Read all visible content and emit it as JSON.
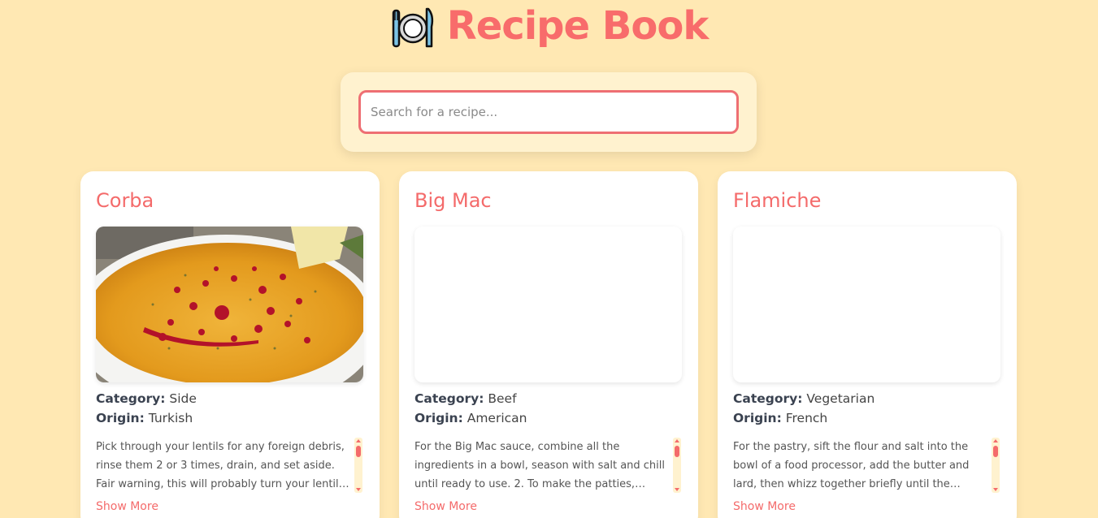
{
  "header": {
    "title": "Recipe Book",
    "logo_icon": "plate-fork-knife-icon"
  },
  "search": {
    "placeholder": "Search for a recipe...",
    "value": ""
  },
  "colors": {
    "background": "#ffe8b3",
    "accent": "#f86c6b",
    "search_border": "#ee6f73"
  },
  "cards": [
    {
      "title": "Corba",
      "category_label": "Category:",
      "category": "Side",
      "origin_label": "Origin:",
      "origin": "Turkish",
      "description": "Pick through your lentils for any foreign debris, rinse them 2 or 3 times, drain, and set aside. Fair warning, this will probably turn your lentils into a...",
      "show_more": "Show More",
      "image": "lentil-soup-image"
    },
    {
      "title": "Big Mac",
      "category_label": "Category:",
      "category": "Beef",
      "origin_label": "Origin:",
      "origin": "American",
      "description": "For the Big Mac sauce, combine all the ingredients in a bowl, season with salt and chill until ready to use. 2. To make the patties, season the mince with...",
      "show_more": "Show More",
      "image": "blank-image"
    },
    {
      "title": "Flamiche",
      "category_label": "Category:",
      "category": "Vegetarian",
      "origin_label": "Origin:",
      "origin": "French",
      "description": "For the pastry, sift the flour and salt into the bowl of a food processor, add the butter and lard, then whizz together briefly until the mixture looks like...",
      "show_more": "Show More",
      "image": "blank-image"
    }
  ]
}
